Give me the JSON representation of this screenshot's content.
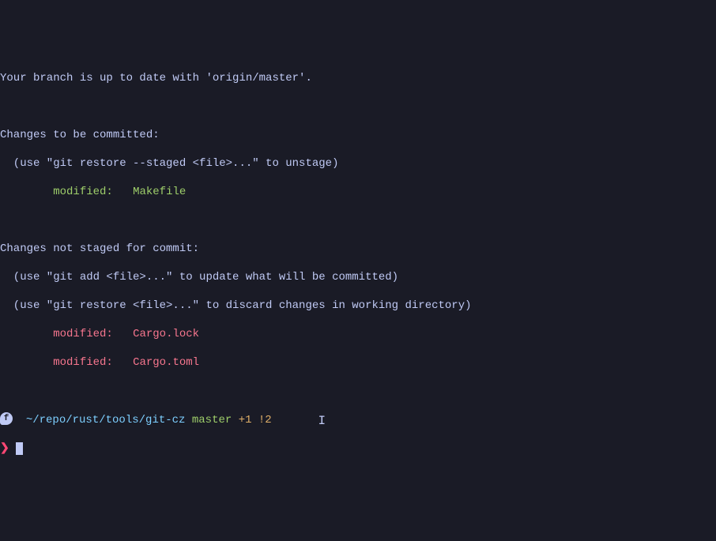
{
  "status": {
    "branch_sync": "Your branch is up to date with 'origin/master'.",
    "staged_header": "Changes to be committed:",
    "staged_hint": "  (use \"git restore --staged <file>...\" to unstage)",
    "staged_files": [
      {
        "status": "modified:",
        "file": "Makefile"
      }
    ],
    "unstaged_header": "Changes not staged for commit:",
    "unstaged_hint1": "  (use \"git add <file>...\" to update what will be committed)",
    "unstaged_hint2": "  (use \"git restore <file>...\" to discard changes in working directory)",
    "unstaged_files": [
      {
        "status": "modified:",
        "file": "Cargo.lock"
      },
      {
        "status": "modified:",
        "file": "Cargo.toml"
      }
    ]
  },
  "prompt": {
    "icon_label": "f",
    "path": "~/repo/rust/tools/git-cz",
    "branch": "master",
    "staged_count": "+1",
    "unstaged_count": "!2",
    "symbol": "❯"
  }
}
